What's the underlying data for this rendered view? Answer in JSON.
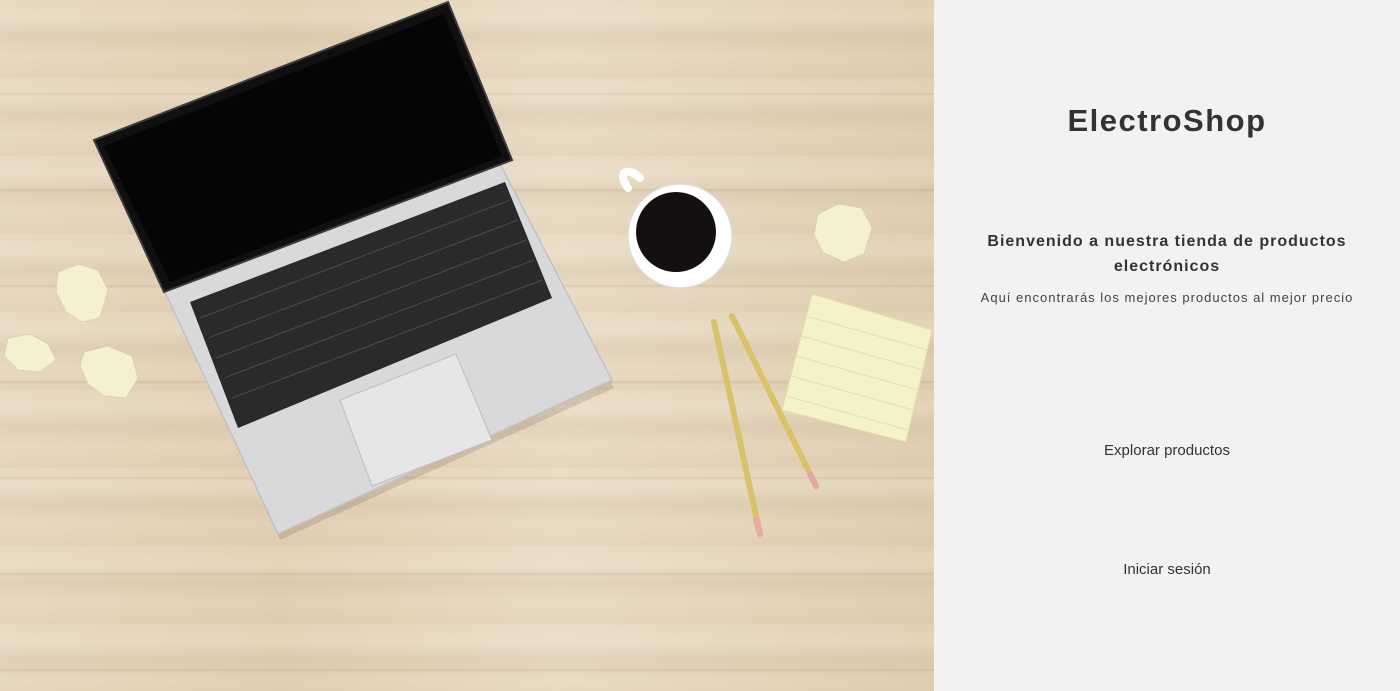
{
  "hero": {
    "icon": "desk-laptop-coffee-photo"
  },
  "panel": {
    "brand": "ElectroShop",
    "welcome": "Bienvenido a nuestra tienda de productos electrónicos",
    "subtitle": "Aquí encontrarás los mejores productos al mejor precio",
    "explore_label": "Explorar productos",
    "login_label": "Iniciar sesión"
  },
  "colors": {
    "panel_bg": "#f2f2f2",
    "text": "#333333",
    "wood": "#e6d6bc"
  }
}
